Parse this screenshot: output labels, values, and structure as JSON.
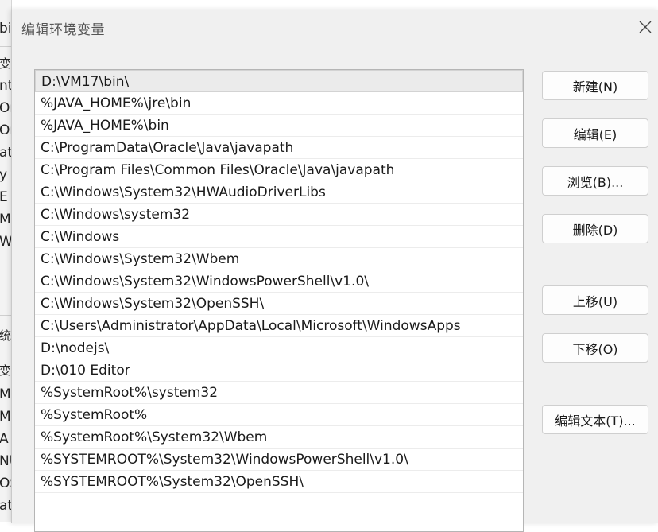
{
  "background_window": {
    "fragments": [
      "bi",
      "变量",
      "nt",
      "On",
      "On",
      "at",
      "y",
      "E",
      "M",
      "Wi",
      "统",
      "变量",
      "M",
      "M",
      "A",
      "NU",
      "OS",
      "at"
    ]
  },
  "dialog": {
    "title": "编辑环境变量",
    "close_icon": "close-icon"
  },
  "path_list": {
    "selected_index": 0,
    "items": [
      "D:\\VM17\\bin\\",
      "%JAVA_HOME%\\jre\\bin",
      "%JAVA_HOME%\\bin",
      "C:\\ProgramData\\Oracle\\Java\\javapath",
      "C:\\Program Files\\Common Files\\Oracle\\Java\\javapath",
      "C:\\Windows\\System32\\HWAudioDriverLibs",
      "C:\\Windows\\system32",
      "C:\\Windows",
      "C:\\Windows\\System32\\Wbem",
      "C:\\Windows\\System32\\WindowsPowerShell\\v1.0\\",
      "C:\\Windows\\System32\\OpenSSH\\",
      "C:\\Users\\Administrator\\AppData\\Local\\Microsoft\\WindowsApps",
      "D:\\nodejs\\",
      "D:\\010 Editor",
      "%SystemRoot%\\system32",
      "%SystemRoot%",
      "%SystemRoot%\\System32\\Wbem",
      "%SYSTEMROOT%\\System32\\WindowsPowerShell\\v1.0\\",
      "%SYSTEMROOT%\\System32\\OpenSSH\\"
    ]
  },
  "buttons": {
    "new": "新建(N)",
    "edit": "编辑(E)",
    "browse": "浏览(B)...",
    "delete": "删除(D)",
    "move_up": "上移(U)",
    "move_down": "下移(O)",
    "edit_text": "编辑文本(T)..."
  }
}
